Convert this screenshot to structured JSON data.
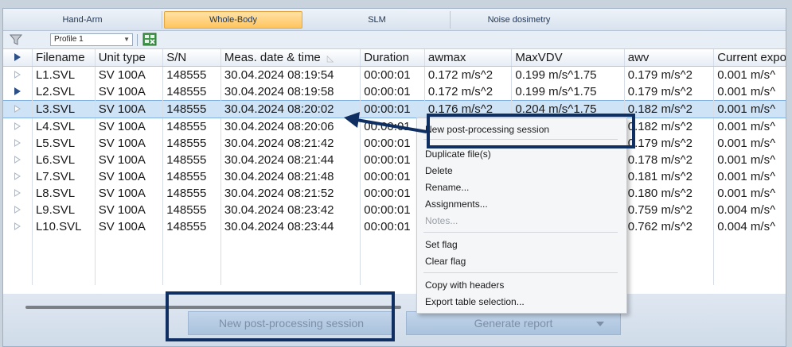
{
  "tabs": [
    {
      "label": "Hand-Arm",
      "active": false
    },
    {
      "label": "Whole-Body",
      "active": true
    },
    {
      "label": "SLM",
      "active": false
    },
    {
      "label": "Noise dosimetry",
      "active": false
    }
  ],
  "toolbar": {
    "profile": "Profile 1"
  },
  "table": {
    "columns": [
      "Filename",
      "Unit type",
      "S/N",
      "Meas. date & time",
      "Duration",
      "awmax",
      "MaxVDV",
      "awv",
      "Current expo"
    ],
    "rows": [
      {
        "flag": "outline",
        "cells": [
          "L1.SVL",
          "SV 100A",
          "148555",
          "30.04.2024 08:19:54",
          "00:00:01",
          "0.172 m/s^2",
          "0.199 m/s^1.75",
          "0.179 m/s^2",
          "0.001 m/s^"
        ]
      },
      {
        "flag": "solid",
        "cells": [
          "L2.SVL",
          "SV 100A",
          "148555",
          "30.04.2024 08:19:58",
          "00:00:01",
          "0.172 m/s^2",
          "0.199 m/s^1.75",
          "0.179 m/s^2",
          "0.001 m/s^"
        ]
      },
      {
        "flag": "outline",
        "cells": [
          "L3.SVL",
          "SV 100A",
          "148555",
          "30.04.2024 08:20:02",
          "00:00:01",
          "0.176 m/s^2",
          "0.204 m/s^1.75",
          "0.182 m/s^2",
          "0.001 m/s^"
        ],
        "selected": true
      },
      {
        "flag": "outline",
        "cells": [
          "L4.SVL",
          "SV 100A",
          "148555",
          "30.04.2024 08:20:06",
          "00:00:01",
          "",
          "",
          "0.182 m/s^2",
          "0.001 m/s^"
        ]
      },
      {
        "flag": "outline",
        "cells": [
          "L5.SVL",
          "SV 100A",
          "148555",
          "30.04.2024 08:21:42",
          "00:00:01",
          "",
          "",
          "0.179 m/s^2",
          "0.001 m/s^"
        ]
      },
      {
        "flag": "outline",
        "cells": [
          "L6.SVL",
          "SV 100A",
          "148555",
          "30.04.2024 08:21:44",
          "00:00:01",
          "",
          "",
          "0.178 m/s^2",
          "0.001 m/s^"
        ]
      },
      {
        "flag": "outline",
        "cells": [
          "L7.SVL",
          "SV 100A",
          "148555",
          "30.04.2024 08:21:48",
          "00:00:01",
          "",
          "",
          "0.181 m/s^2",
          "0.001 m/s^"
        ]
      },
      {
        "flag": "outline",
        "cells": [
          "L8.SVL",
          "SV 100A",
          "148555",
          "30.04.2024 08:21:52",
          "00:00:01",
          "",
          "",
          "0.180 m/s^2",
          "0.001 m/s^"
        ]
      },
      {
        "flag": "outline",
        "cells": [
          "L9.SVL",
          "SV 100A",
          "148555",
          "30.04.2024 08:23:42",
          "00:00:01",
          "",
          "",
          "0.759 m/s^2",
          "0.004 m/s^"
        ]
      },
      {
        "flag": "outline",
        "cells": [
          "L10.SVL",
          "SV 100A",
          "148555",
          "30.04.2024 08:23:44",
          "00:00:01",
          "",
          "",
          "0.762 m/s^2",
          "0.004 m/s^"
        ]
      }
    ]
  },
  "context_menu": {
    "items": [
      {
        "label": "New post-processing session",
        "disabled": false
      },
      {
        "label": "Duplicate file(s)",
        "disabled": false
      },
      {
        "label": "Delete",
        "disabled": false
      },
      {
        "label": "Rename...",
        "disabled": false
      },
      {
        "label": "Assignments...",
        "disabled": false
      },
      {
        "label": "Notes...",
        "disabled": true
      },
      {
        "label": "Set flag",
        "disabled": false
      },
      {
        "label": "Clear flag",
        "disabled": false
      },
      {
        "label": "Copy with headers",
        "disabled": false
      },
      {
        "label": "Export table selection...",
        "disabled": false
      }
    ]
  },
  "buttons": {
    "new_session": "New post-processing session",
    "generate_report": "Generate report"
  },
  "colors": {
    "active_tab": "#ffc55e",
    "highlight_box": "#0f2f63",
    "selection": "#cfe3f7"
  }
}
